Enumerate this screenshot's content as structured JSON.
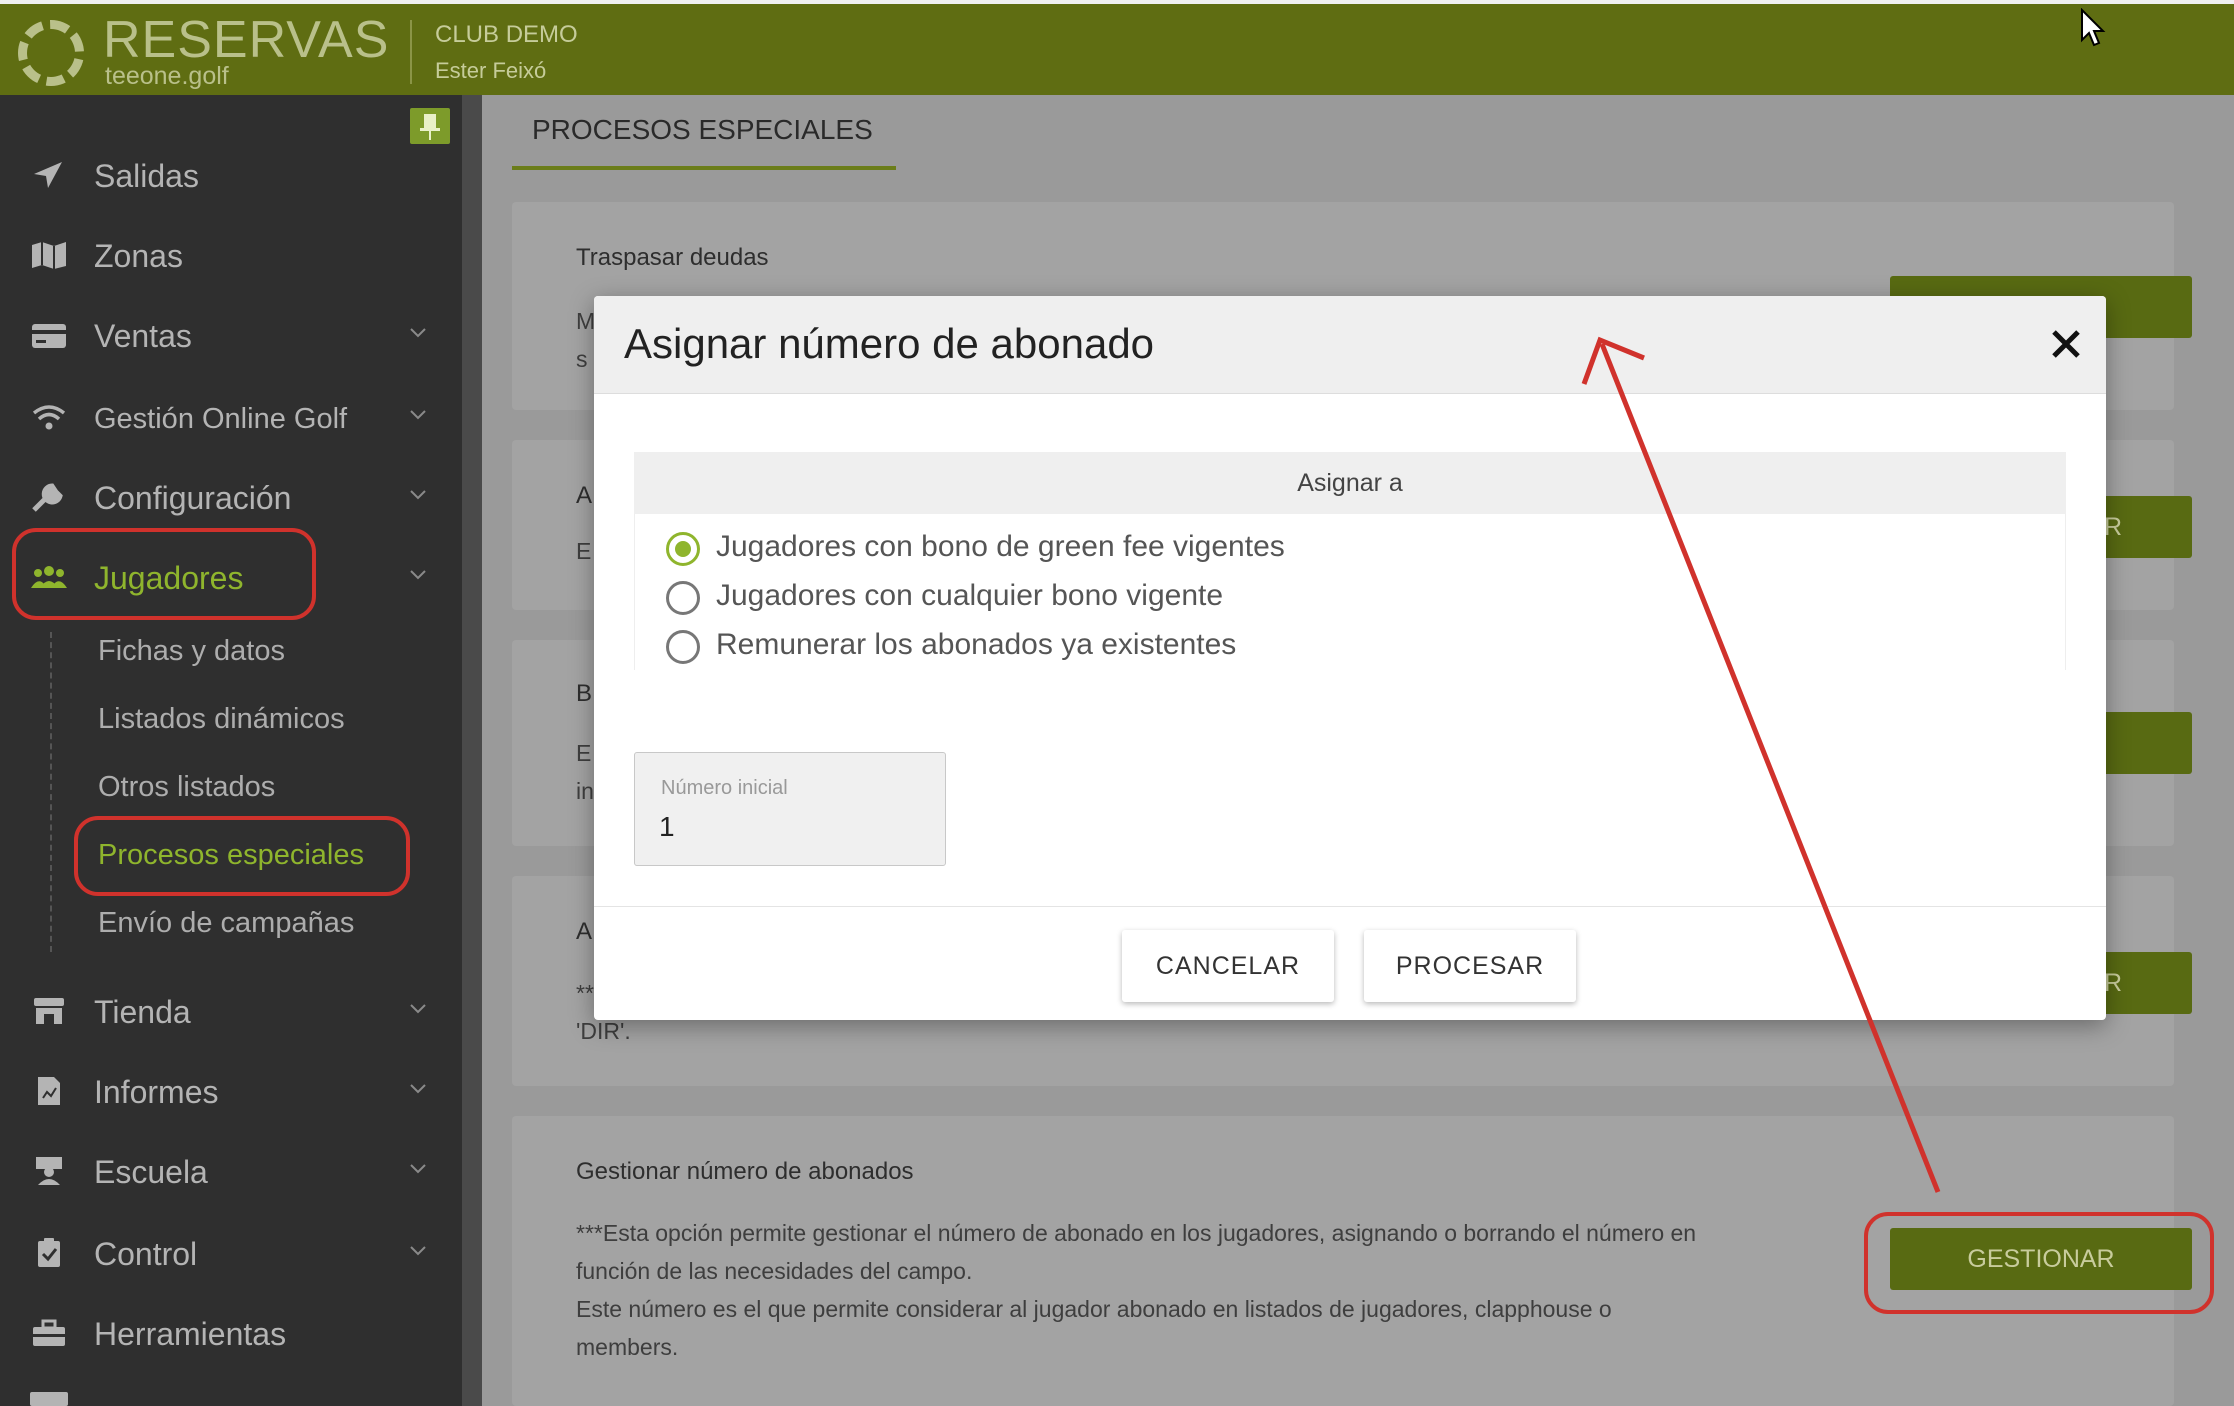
{
  "topbar": {
    "logo_title": "RESERVAS",
    "logo_subtitle": "teeone.golf",
    "club_name": "CLUB DEMO",
    "user_name": "Ester Feixó"
  },
  "sidebar": {
    "items": [
      {
        "label": "Salidas",
        "icon": "paper-plane-icon"
      },
      {
        "label": "Zonas",
        "icon": "map-icon"
      },
      {
        "label": "Ventas",
        "icon": "credit-card-icon"
      },
      {
        "label": "Gestión Online Golf",
        "icon": "wifi-icon"
      },
      {
        "label": "Configuración",
        "icon": "wrench-icon"
      },
      {
        "label": "Jugadores",
        "icon": "users-icon"
      },
      {
        "label": "Tienda",
        "icon": "store-icon"
      },
      {
        "label": "Informes",
        "icon": "report-icon"
      },
      {
        "label": "Escuela",
        "icon": "teacher-icon"
      },
      {
        "label": "Control",
        "icon": "clipboard-icon"
      },
      {
        "label": "Herramientas",
        "icon": "toolbox-icon"
      }
    ],
    "subitems": [
      "Fichas y datos",
      "Listados dinámicos",
      "Otros listados",
      "Procesos especiales",
      "Envío de campañas"
    ]
  },
  "main": {
    "tab_label": "PROCESOS ESPECIALES",
    "card1_title": "Traspasar deudas",
    "card_fragment_m": "M",
    "card_fragment_s": "s",
    "card_fragment_a1": "A",
    "card_fragment_e1": "E",
    "card_fragment_b": "B",
    "card_fragment_e2": "E",
    "card_fragment_in": "in",
    "card_fragment_a2": "A",
    "card_fragment_stars": "**",
    "card_fragment_dir": "'DIR'.",
    "btn_fragment_r": "R",
    "card5_title": "Gestionar número de abonados",
    "card5_lines": [
      "***Esta opción permite gestionar el número de abonado en los jugadores, asignando o borrando el número en",
      "función de las necesidades del campo.",
      "Este número es el que permite considerar al jugador abonado en listados de jugadores, clapphouse o",
      "members."
    ],
    "gestionar_label": "GESTIONAR"
  },
  "modal": {
    "title": "Asignar número de abonado",
    "section_label": "Asignar a",
    "options": [
      "Jugadores con bono de green fee vigentes",
      "Jugadores con cualquier bono vigente",
      "Remunerar los abonados ya existentes"
    ],
    "selected_index": 0,
    "field_label": "Número inicial",
    "field_value": "1",
    "cancel_label": "CANCELAR",
    "process_label": "PROCESAR"
  },
  "colors": {
    "brand_green": "#5f6d12",
    "accent_green": "#8fb52d",
    "annotation_red": "#d0322c"
  }
}
